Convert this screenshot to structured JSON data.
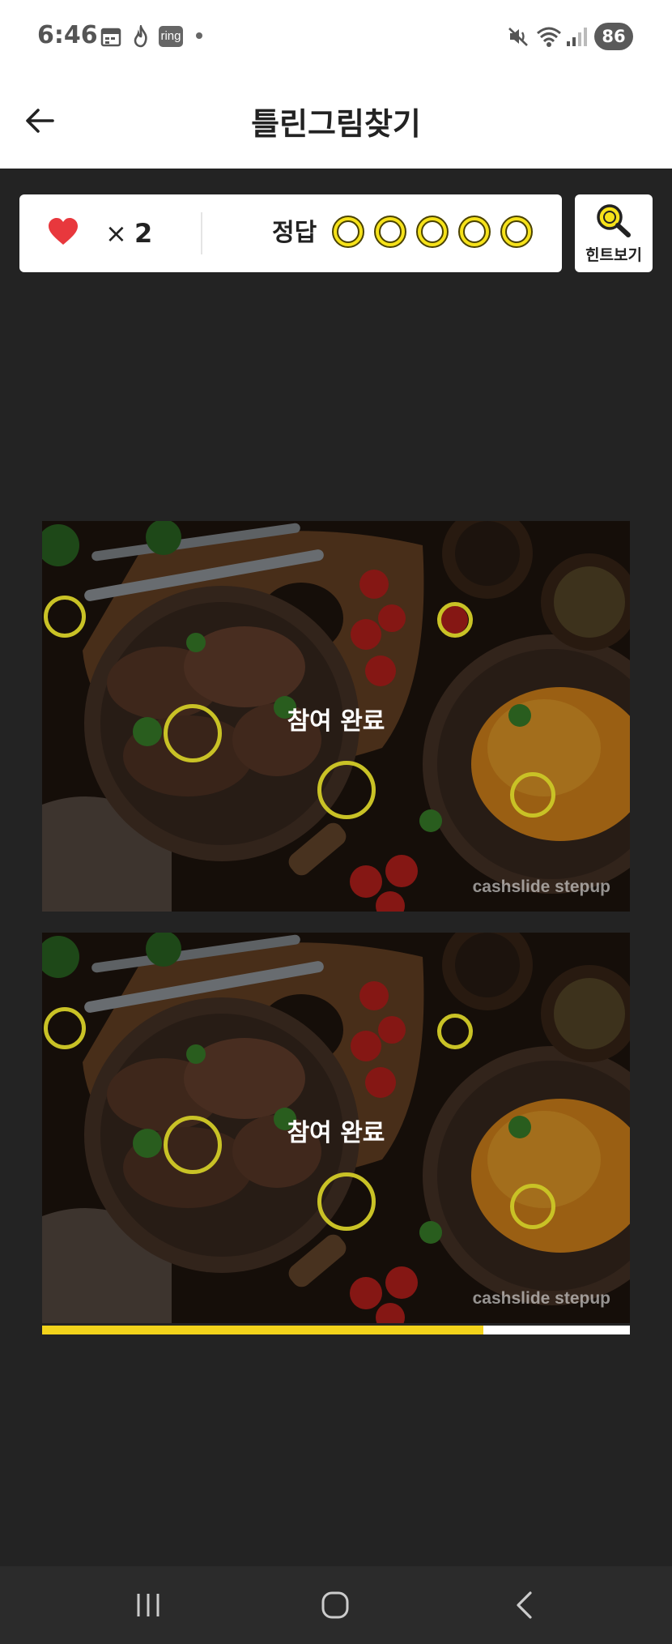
{
  "status_bar": {
    "time": "6:46",
    "ring_badge": "ring",
    "battery": "86"
  },
  "header": {
    "title": "틀린그림찾기"
  },
  "score": {
    "times": "×",
    "lives": "2",
    "answer_label": "정답",
    "slots_total": 5,
    "slots_found": 0
  },
  "hint": {
    "label": "힌트보기"
  },
  "puzzle": {
    "status_text": "참여 완료",
    "watermark": "cashslide stepup"
  },
  "progress": {
    "fraction": 0.75
  },
  "colors": {
    "accent": "#f2d31b",
    "heart": "#e8383d",
    "mark": "#c9c226",
    "background": "#232323"
  },
  "icons": [
    "back-arrow-icon",
    "heart-icon",
    "magnifier-icon",
    "recent-apps-icon",
    "home-icon",
    "nav-back-icon"
  ]
}
